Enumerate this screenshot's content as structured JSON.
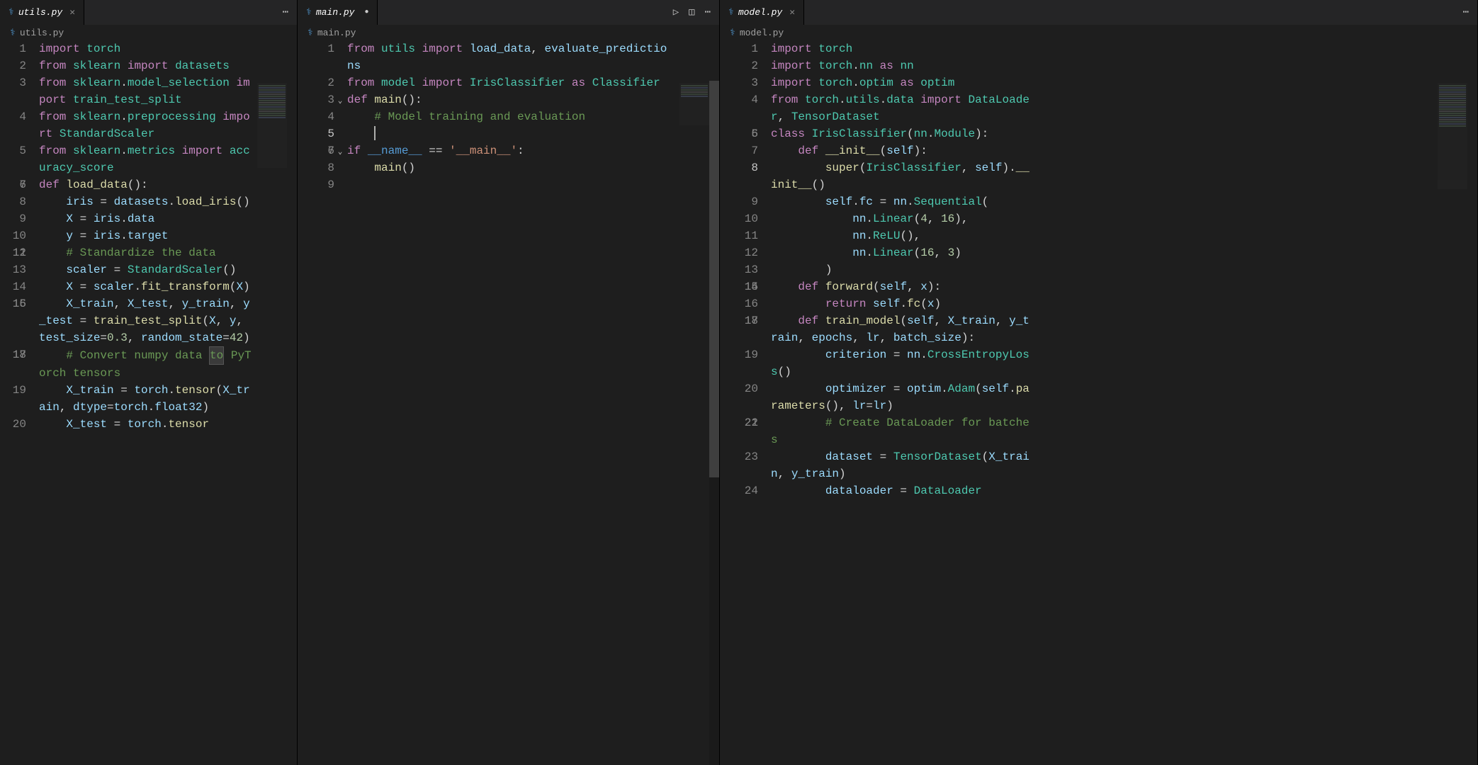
{
  "panes": {
    "left": {
      "tab": {
        "filename": "utils.py",
        "dirty": false
      },
      "breadcrumb": "utils.py",
      "actions": {
        "overflow": "⋯"
      },
      "lines": [
        {
          "n": 1,
          "html": "<span class='tok-kw'>import</span> <span class='tok-mod'>torch</span>"
        },
        {
          "n": 2,
          "html": "<span class='tok-kw'>from</span> <span class='tok-mod'>sklearn</span> <span class='tok-kw'>import</span> <span class='tok-mod'>datasets</span>"
        },
        {
          "n": 3,
          "html": "<span class='tok-kw'>from</span> <span class='tok-mod'>sklearn</span>.<span class='tok-mod'>model_selection</span> <span class='tok-kw'>import</span> <span class='tok-mod'>train_test_split</span>"
        },
        {
          "n": 4,
          "html": "<span class='tok-kw'>from</span> <span class='tok-mod'>sklearn</span>.<span class='tok-mod'>preprocessing</span> <span class='tok-kw'>import</span> <span class='tok-mod'>StandardScaler</span>"
        },
        {
          "n": 5,
          "html": "<span class='tok-kw'>from</span> <span class='tok-mod'>sklearn</span>.<span class='tok-mod'>metrics</span> <span class='tok-kw'>import</span> <span class='tok-mod'>accuracy_score</span>"
        },
        {
          "n": 6,
          "html": ""
        },
        {
          "n": 7,
          "html": "<span class='tok-kw'>def</span> <span class='tok-fn'>load_data</span>():"
        },
        {
          "n": 8,
          "html": "    <span class='tok-var'>iris</span> = <span class='tok-var'>datasets</span>.<span class='tok-fn'>load_iris</span>()"
        },
        {
          "n": 9,
          "html": "    <span class='tok-var'>X</span> = <span class='tok-var'>iris</span>.<span class='tok-var'>data</span>"
        },
        {
          "n": 10,
          "html": "    <span class='tok-var'>y</span> = <span class='tok-var'>iris</span>.<span class='tok-var'>target</span>"
        },
        {
          "n": 11,
          "html": ""
        },
        {
          "n": 12,
          "html": "    <span class='tok-cmt'># Standardize the data</span>"
        },
        {
          "n": 13,
          "html": "    <span class='tok-var'>scaler</span> = <span class='tok-cls'>StandardScaler</span>()"
        },
        {
          "n": 14,
          "html": "    <span class='tok-var'>X</span> = <span class='tok-var'>scaler</span>.<span class='tok-fn'>fit_transform</span>(<span class='tok-var'>X</span>)"
        },
        {
          "n": 15,
          "html": ""
        },
        {
          "n": 16,
          "html": "    <span class='tok-var'>X_train</span>, <span class='tok-var'>X_test</span>, <span class='tok-var'>y_train</span>, <span class='tok-var'>y_test</span> = <span class='tok-fn'>train_test_split</span>(<span class='tok-var'>X</span>, <span class='tok-var'>y</span>, <span class='tok-prm'>test_size</span>=<span class='tok-num'>0.3</span>, <span class='tok-prm'>random_state</span>=<span class='tok-num'>42</span>)"
        },
        {
          "n": 17,
          "html": ""
        },
        {
          "n": 18,
          "html": "    <span class='tok-cmt'># Convert numpy data </span><span class='tok-cmt highlight-box'>to</span><span class='tok-cmt'> PyTorch tensors</span>"
        },
        {
          "n": 19,
          "html": "    <span class='tok-var'>X_train</span> = <span class='tok-var'>torch</span>.<span class='tok-fn'>tensor</span>(<span class='tok-var'>X_train</span>, <span class='tok-prm'>dtype</span>=<span class='tok-var'>torch</span>.<span class='tok-var'>float32</span>)"
        },
        {
          "n": 20,
          "html": "    <span class='tok-var'>X_test</span> = <span class='tok-var'>torch</span>.<span class='tok-fn'>tensor</span>"
        }
      ]
    },
    "mid": {
      "tab": {
        "filename": "main.py",
        "dirty": true
      },
      "breadcrumb": "main.py",
      "actions": {
        "run": "▷",
        "split": "◫",
        "overflow": "⋯"
      },
      "breakpoint_line": 1,
      "current_line": 5,
      "lines": [
        {
          "n": 1,
          "html": "<span class='tok-kw'>from</span> <span class='tok-mod'>utils</span> <span class='tok-kw'>import</span> <span class='tok-var'>load_data</span>, <span class='tok-var'>evaluate_predictions</span>"
        },
        {
          "n": 2,
          "html": "<span class='tok-kw'>from</span> <span class='tok-mod'>model</span> <span class='tok-kw'>import</span> <span class='tok-cls'>IrisClassifier</span> <span class='tok-kw'>as</span> <span class='tok-cls'>Classifier</span>"
        },
        {
          "n": 3,
          "html": "<span class='tok-kw'>def</span> <span class='tok-fn'>main</span>():",
          "fold": true
        },
        {
          "n": 4,
          "html": "    <span class='tok-cmt'># Model training and evaluation</span>"
        },
        {
          "n": 5,
          "html": "    <span class='cursor'></span>",
          "current": true
        },
        {
          "n": 6,
          "html": ""
        },
        {
          "n": 7,
          "html": "<span class='tok-kw'>if</span> <span class='tok-spc'>__name__</span> == <span class='tok-str'>'__main__'</span>:",
          "fold": true
        },
        {
          "n": 8,
          "html": "    <span class='tok-fn'>main</span>()"
        },
        {
          "n": 9,
          "html": ""
        }
      ]
    },
    "right": {
      "tab": {
        "filename": "model.py",
        "dirty": false
      },
      "breadcrumb": "model.py",
      "actions": {
        "overflow": "⋯"
      },
      "current_line": 8,
      "lines": [
        {
          "n": 1,
          "html": "<span class='tok-kw'>import</span> <span class='tok-mod'>torch</span>"
        },
        {
          "n": 2,
          "html": "<span class='tok-kw'>import</span> <span class='tok-mod'>torch</span>.<span class='tok-mod'>nn</span> <span class='tok-kw'>as</span> <span class='tok-mod'>nn</span>"
        },
        {
          "n": 3,
          "html": "<span class='tok-kw'>import</span> <span class='tok-mod'>torch</span>.<span class='tok-mod'>optim</span> <span class='tok-kw'>as</span> <span class='tok-mod'>optim</span>"
        },
        {
          "n": 4,
          "html": "<span class='tok-kw'>from</span> <span class='tok-mod'>torch</span>.<span class='tok-mod'>utils</span>.<span class='tok-mod'>data</span> <span class='tok-kw'>import</span> <span class='tok-mod'>DataLoader</span>, <span class='tok-mod'>TensorDataset</span>"
        },
        {
          "n": 5,
          "html": ""
        },
        {
          "n": 6,
          "html": "<span class='tok-kw'>class</span> <span class='tok-cls'>IrisClassifier</span>(<span class='tok-cls'>nn</span>.<span class='tok-cls'>Module</span>):"
        },
        {
          "n": 7,
          "html": "    <span class='tok-kw'>def</span> <span class='tok-fn'>__init__</span>(<span class='tok-self'>self</span>):"
        },
        {
          "n": 8,
          "html": "        <span class='tok-builtin'>super</span>(<span class='tok-cls'>IrisClassifier</span>, <span class='tok-self'>self</span>).<span class='tok-fn'>__init__</span>()",
          "current": true
        },
        {
          "n": 9,
          "html": "        <span class='tok-self'>self</span>.<span class='tok-var'>fc</span> = <span class='tok-var'>nn</span>.<span class='tok-cls'>Sequential</span>("
        },
        {
          "n": 10,
          "html": "            <span class='tok-var'>nn</span>.<span class='tok-cls'>Linear</span>(<span class='tok-num'>4</span>, <span class='tok-num'>16</span>),"
        },
        {
          "n": 11,
          "html": "            <span class='tok-var'>nn</span>.<span class='tok-cls'>ReLU</span>(),"
        },
        {
          "n": 12,
          "html": "            <span class='tok-var'>nn</span>.<span class='tok-cls'>Linear</span>(<span class='tok-num'>16</span>, <span class='tok-num'>3</span>)"
        },
        {
          "n": 13,
          "html": "        )"
        },
        {
          "n": 14,
          "html": ""
        },
        {
          "n": 15,
          "html": "    <span class='tok-kw'>def</span> <span class='tok-fn'>forward</span>(<span class='tok-self'>self</span>, <span class='tok-prm'>x</span>):"
        },
        {
          "n": 16,
          "html": "        <span class='tok-kw'>return</span> <span class='tok-self'>self</span>.<span class='tok-fn'>fc</span>(<span class='tok-var'>x</span>)"
        },
        {
          "n": 17,
          "html": ""
        },
        {
          "n": 18,
          "html": "    <span class='tok-kw'>def</span> <span class='tok-fn'>train_model</span>(<span class='tok-self'>self</span>, <span class='tok-prm'>X_train</span>, <span class='tok-prm'>y_train</span>, <span class='tok-prm'>epochs</span>, <span class='tok-prm'>lr</span>, <span class='tok-prm'>batch_size</span>):"
        },
        {
          "n": 19,
          "html": "        <span class='tok-var'>criterion</span> = <span class='tok-var'>nn</span>.<span class='tok-cls'>CrossEntropyLoss</span>()"
        },
        {
          "n": 20,
          "html": "        <span class='tok-var'>optimizer</span> = <span class='tok-var'>optim</span>.<span class='tok-cls'>Adam</span>(<span class='tok-self'>self</span>.<span class='tok-fn'>parameters</span>(), <span class='tok-prm'>lr</span>=<span class='tok-var'>lr</span>)"
        },
        {
          "n": 21,
          "html": ""
        },
        {
          "n": 22,
          "html": "        <span class='tok-cmt'># Create DataLoader for batches</span>"
        },
        {
          "n": 23,
          "html": "        <span class='tok-var'>dataset</span> = <span class='tok-cls'>TensorDataset</span>(<span class='tok-var'>X_train</span>, <span class='tok-var'>y_train</span>)"
        },
        {
          "n": 24,
          "html": "        <span class='tok-var'>dataloader</span> = <span class='tok-cls'>DataLoader</span>"
        }
      ]
    }
  }
}
